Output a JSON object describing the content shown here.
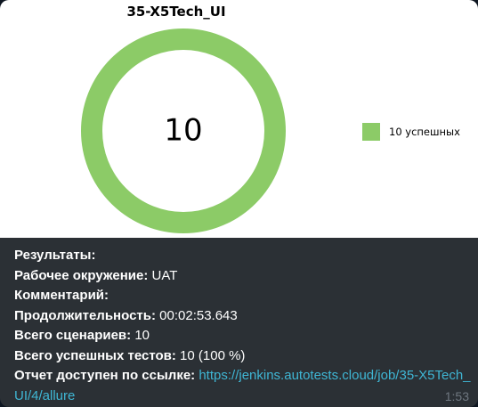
{
  "message": {
    "chart_image": {
      "title": "35-X5Tech_UI",
      "center_label": "10",
      "legend_label": "10 успешных",
      "accent_color": "#8ccb67"
    },
    "lines": {
      "results_label": "Результаты:",
      "environment_label": "Рабочее окружение:",
      "environment_value": "UAT",
      "comment_label": "Комментарий:",
      "duration_label": "Продолжительность:",
      "duration_value": "00:02:53.643",
      "scenarios_label": "Всего сценариев:",
      "scenarios_value": "10",
      "passed_label": "Всего успешных тестов:",
      "passed_value": "10 (100 %)",
      "report_label": "Отчет доступен по ссылке:",
      "report_link": "https://jenkins.autotests.cloud/job/35-X5Tech_UI/4/allure"
    },
    "time": "1:53"
  },
  "chart_data": {
    "type": "pie",
    "title": "35-X5Tech_UI",
    "categories": [
      "успешных"
    ],
    "values": [
      10
    ],
    "center_label": "10",
    "legend": [
      "10 успешных"
    ],
    "legend_position": "right",
    "colors": [
      "#8ccb67"
    ]
  }
}
